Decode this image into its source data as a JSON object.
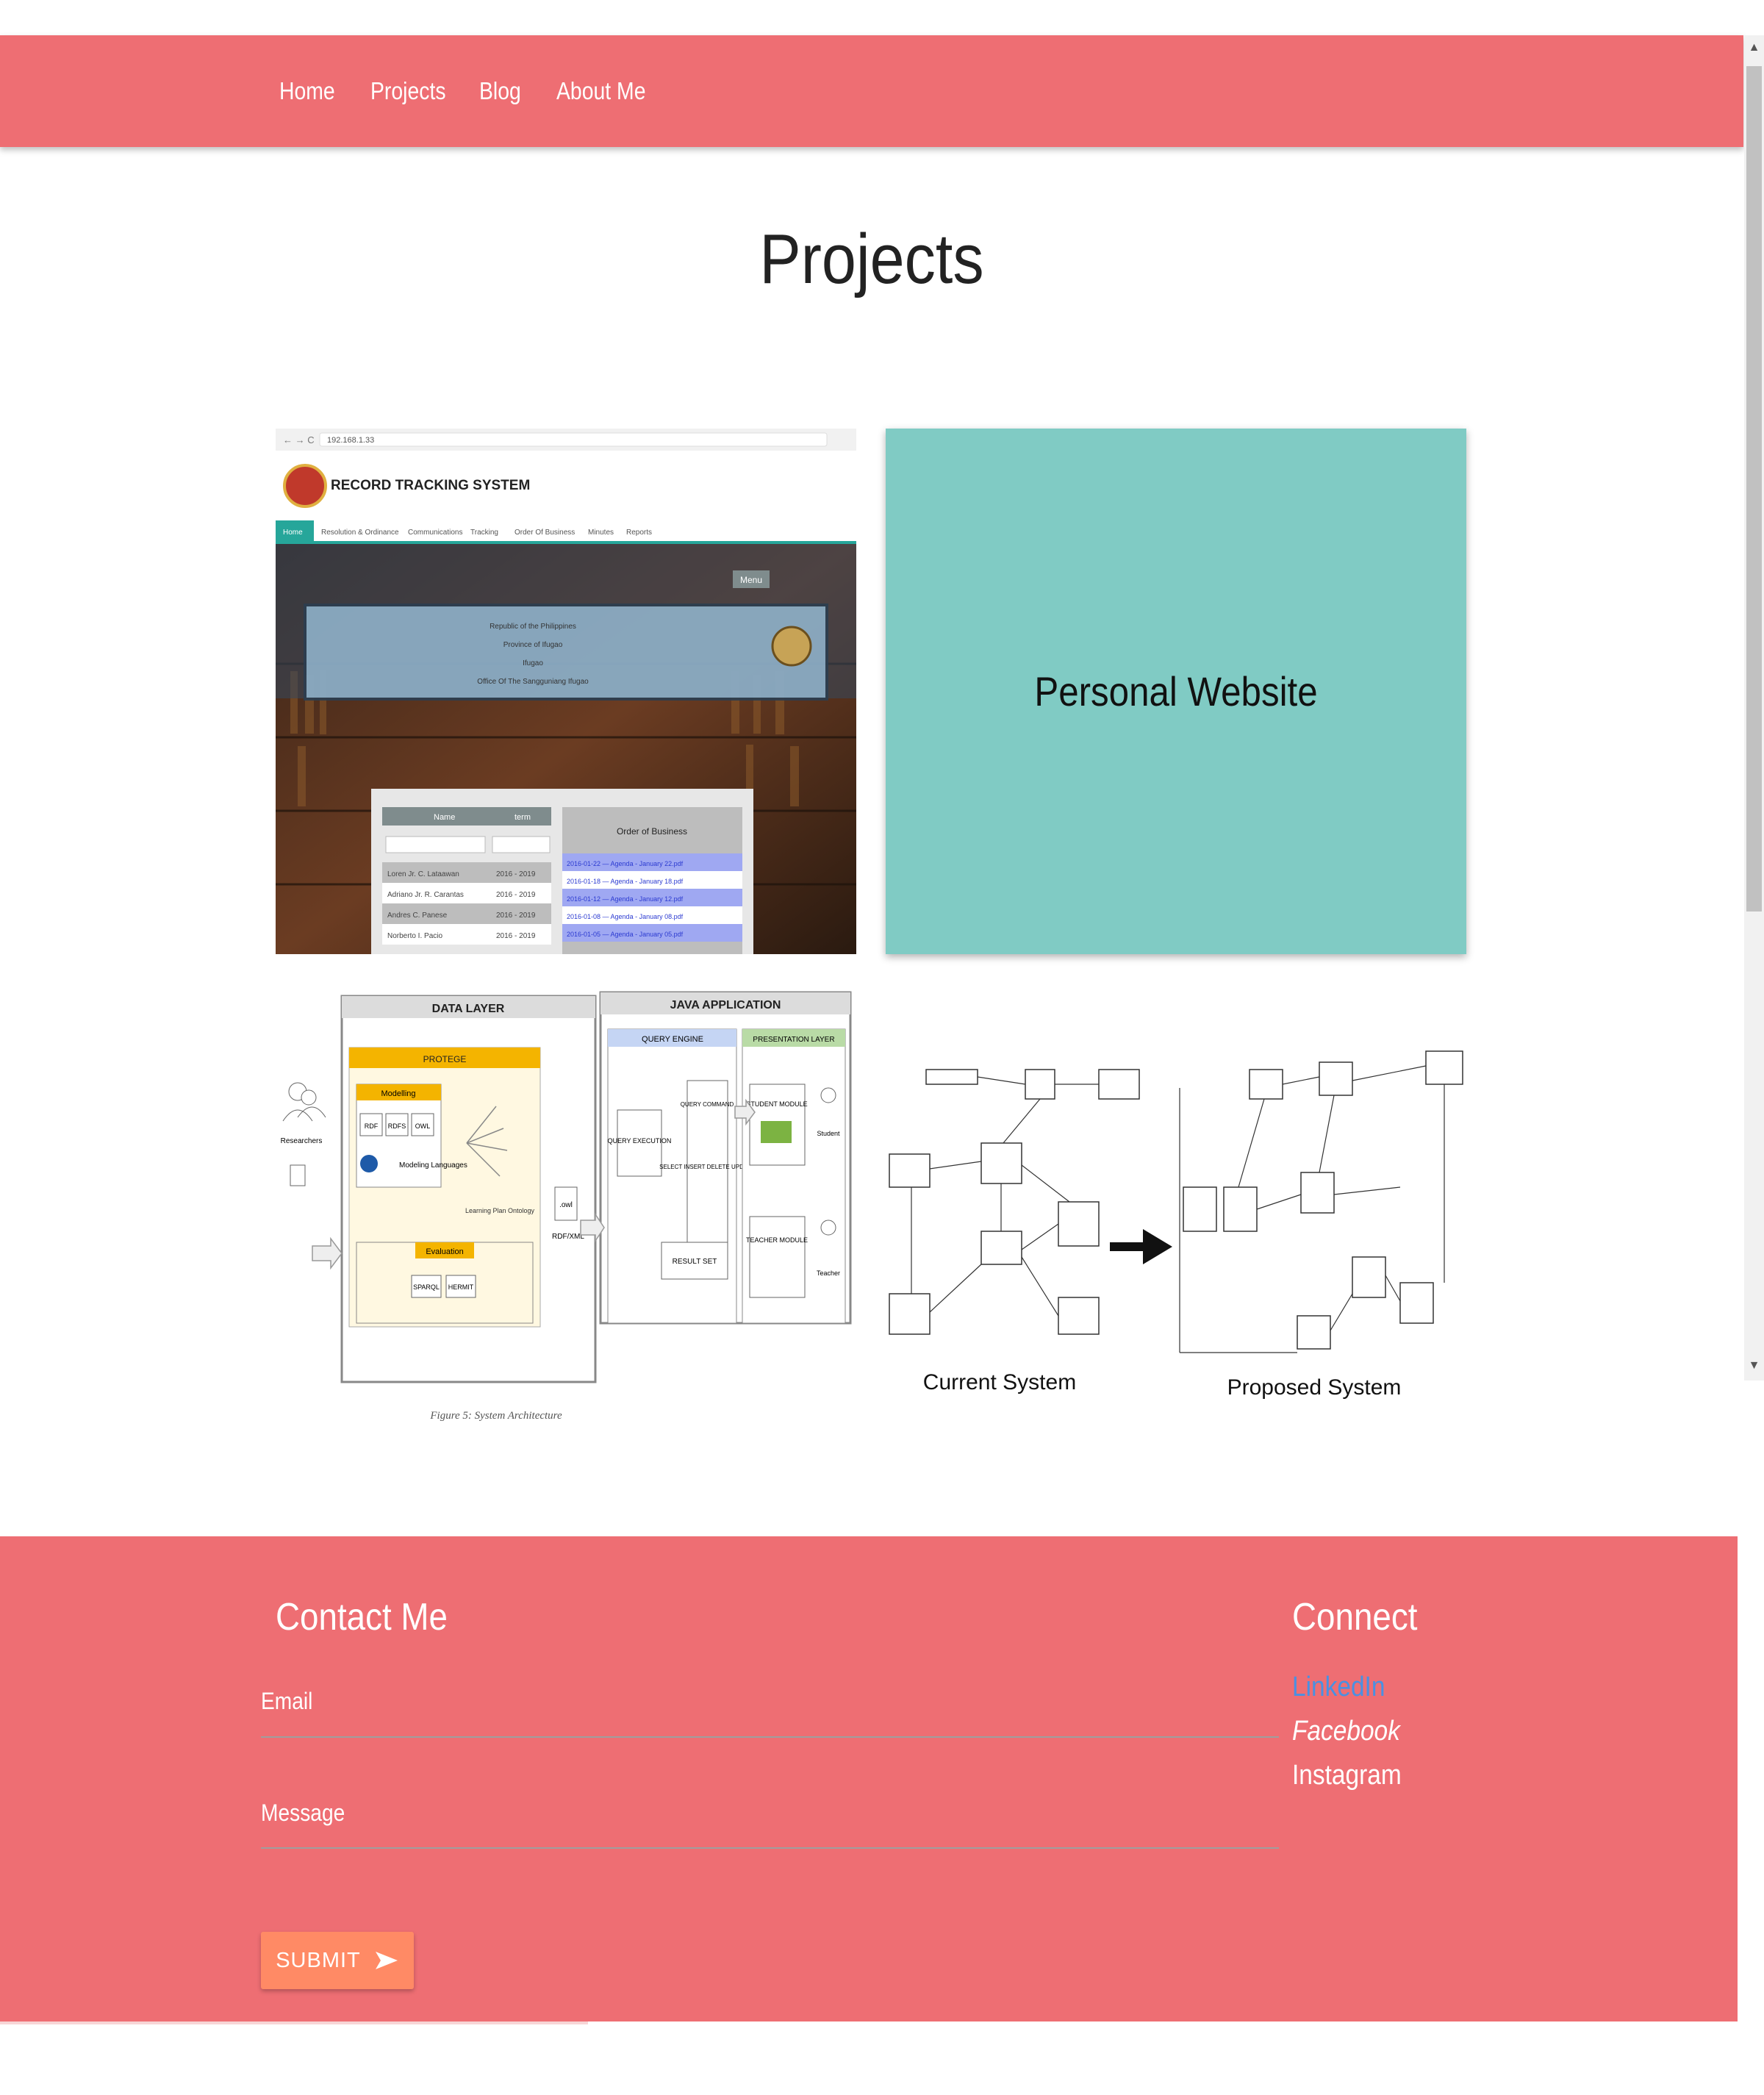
{
  "nav": {
    "items": [
      {
        "label": "Home"
      },
      {
        "label": "Projects"
      },
      {
        "label": "Blog"
      },
      {
        "label": "About Me"
      }
    ]
  },
  "page": {
    "title": "Projects"
  },
  "projects": {
    "record_tracking": {
      "app_title": "RECORD TRACKING SYSTEM",
      "url": "192.168.1.33",
      "tabs": [
        "Home",
        "Resolution & Ordinance",
        "Communications",
        "Tracking",
        "Order Of Business",
        "Minutes",
        "Reports"
      ],
      "menu_label": "Menu",
      "banner_lines": [
        "Republic of the Philippines",
        "Province of Ifugao",
        "Ifugao",
        "Office Of The Sangguniang Ifugao"
      ],
      "table_headers": [
        "Name",
        "term"
      ],
      "table_rows": [
        [
          "Loren Jr. C. Lataawan",
          "2016 - 2019"
        ],
        [
          "Adriano Jr. R. Carantas",
          "2016 - 2019"
        ],
        [
          "Andres C. Panese",
          "2016 - 2019"
        ],
        [
          "Norberto I. Pacio",
          "2016 - 2019"
        ]
      ],
      "order_title": "Order of Business",
      "order_items": [
        "2016-01-22 — Agenda - January 22.pdf",
        "2016-01-18 — Agenda - January 18.pdf",
        "2016-01-12 — Agenda - January 12.pdf",
        "2016-01-08 — Agenda - January 08.pdf",
        "2016-01-05 — Agenda - January 05.pdf"
      ]
    },
    "personal_website": {
      "title": "Personal Website"
    },
    "architecture": {
      "data_layer": "DATA LAYER",
      "java_app": "JAVA APPLICATION",
      "protege": "PROTEGE",
      "modelling": "Modelling",
      "formats": [
        "RDF",
        "RDFS",
        "OWL"
      ],
      "modeling_languages": "Modeling Languages",
      "evaluation": "Evaluation",
      "tools": [
        "SPARQL",
        "HERMIT"
      ],
      "ontology_label": "Learning Plan Ontology",
      "query_engine": "QUERY ENGINE",
      "presentation_layer": "PRESENTATION LAYER",
      "query_execution": "QUERY EXECUTION",
      "query_command": "QUERY COMMAND",
      "commands": "SELECT INSERT DELETE UPDATE",
      "result_set": "RESULT SET",
      "student_module": "STUDENT MODULE",
      "teacher_module": "TEACHER MODULE",
      "student": "Student",
      "teacher": "Teacher",
      "researchers": "Researchers",
      "rdf_xml": "RDF/XML",
      "owl_file": ".owl",
      "caption": "Figure 5: System Architecture"
    },
    "systems": {
      "current_label": "Current System",
      "proposed_label": "Proposed System"
    }
  },
  "footer": {
    "contact_title": "Contact Me",
    "email_label": "Email",
    "message_label": "Message",
    "submit_label": "SUBMIT",
    "connect_title": "Connect",
    "links": {
      "linkedin": "LinkedIn",
      "facebook": "Facebook",
      "instagram": "Instagram"
    }
  },
  "colors": {
    "primary": "#ee6e73",
    "teal_card": "#80cbc4",
    "button": "#ff8a65",
    "linkedin": "#4a90e2"
  }
}
